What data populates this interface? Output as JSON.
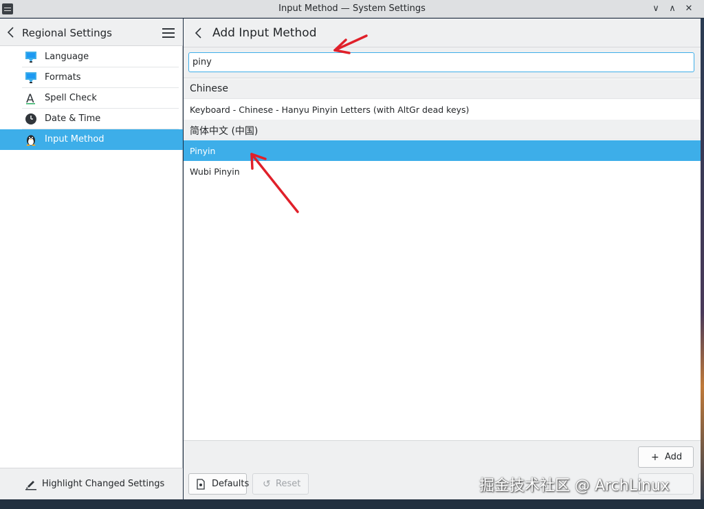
{
  "window": {
    "title": "Input Method — System Settings",
    "minimize": "∨",
    "maximize": "∧",
    "close": "✕"
  },
  "sidebar": {
    "title": "Regional Settings",
    "items": [
      {
        "label": "Language",
        "icon": "language-flag-icon"
      },
      {
        "label": "Formats",
        "icon": "formats-flag-icon"
      },
      {
        "label": "Spell Check",
        "icon": "spell-check-icon"
      },
      {
        "label": "Date & Time",
        "icon": "clock-icon"
      },
      {
        "label": "Input Method",
        "icon": "penguin-icon",
        "selected": true
      }
    ],
    "footer_label": "Highlight Changed Settings"
  },
  "page": {
    "title": "Add Input Method",
    "search": {
      "value": "piny",
      "placeholder": ""
    },
    "groups": [
      {
        "name": "Chinese",
        "items": [
          {
            "label": "Keyboard - Chinese - Hanyu Pinyin Letters (with AltGr dead keys)"
          }
        ]
      },
      {
        "name": "简体中文 (中国)",
        "items": [
          {
            "label": "Pinyin",
            "selected": true
          },
          {
            "label": "Wubi Pinyin"
          }
        ]
      }
    ],
    "buttons": {
      "add": "Add",
      "defaults": "Defaults",
      "reset": "Reset"
    }
  },
  "watermark": "掘金技术社区 @ ArchLinux",
  "colors": {
    "accent": "#3daee9",
    "arrow": "#e0202a",
    "header_bg": "#eff0f1"
  }
}
